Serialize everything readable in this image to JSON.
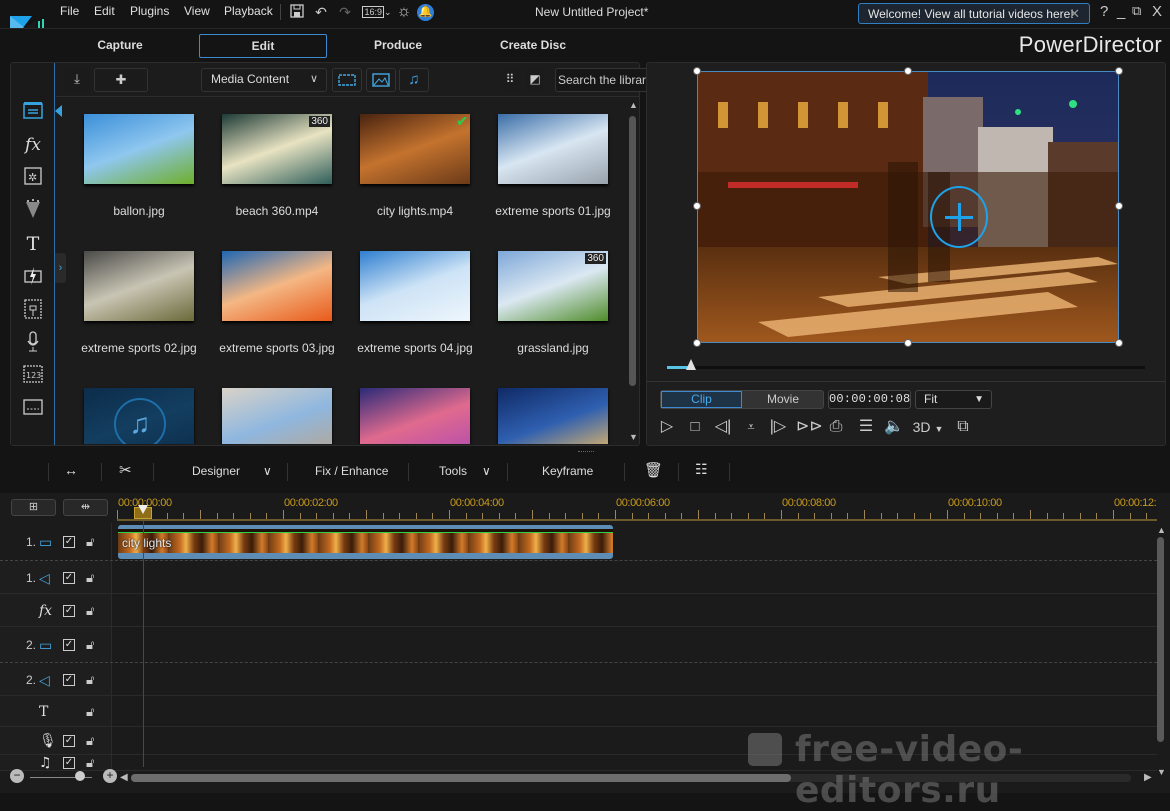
{
  "app": {
    "project_title": "New Untitled Project*",
    "brand": "PowerDirector",
    "welcome_tip": "Welcome! View all tutorial videos here!",
    "aspect_ratio": "16:9"
  },
  "menu": [
    "File",
    "Edit",
    "Plugins",
    "View",
    "Playback"
  ],
  "window_controls": {
    "help": "?",
    "minimize": "_",
    "restore": "⧉",
    "close": "X"
  },
  "modes": [
    {
      "label": "Capture",
      "active": false
    },
    {
      "label": "Edit",
      "active": true
    },
    {
      "label": "Produce",
      "active": false
    },
    {
      "label": "Create Disc",
      "active": false
    }
  ],
  "rooms": [
    {
      "name": "media-room",
      "glyph": "🎬",
      "active": true
    },
    {
      "name": "fx-room",
      "glyph": "fx"
    },
    {
      "name": "pip-room",
      "glyph": "✲"
    },
    {
      "name": "particle-room",
      "glyph": "▼"
    },
    {
      "name": "title-room",
      "glyph": "T"
    },
    {
      "name": "transition-room",
      "glyph": "ϟ"
    },
    {
      "name": "audio-mixing-room",
      "glyph": "⊞"
    },
    {
      "name": "voiceover-room",
      "glyph": "🎙"
    },
    {
      "name": "chapter-room",
      "glyph": "123"
    },
    {
      "name": "subtitle-room",
      "glyph": "▭"
    }
  ],
  "library": {
    "content_filter": "Media Content",
    "search_placeholder": "Search the library",
    "items": [
      {
        "name": "ballon.jpg",
        "badge": "",
        "used": false,
        "colors": [
          "#3b8fd9",
          "#8fc7ef",
          "#6fae2a"
        ]
      },
      {
        "name": "beach 360.mp4",
        "badge": "360",
        "used": false,
        "colors": [
          "#1d3a36",
          "#e8e3c2",
          "#2f5e5a"
        ]
      },
      {
        "name": "city lights.mp4",
        "badge": "",
        "used": true,
        "colors": [
          "#4a2310",
          "#c4732e",
          "#6b3a18"
        ]
      },
      {
        "name": "extreme sports 01.jpg",
        "badge": "",
        "used": false,
        "colors": [
          "#3a6ea8",
          "#d8e6f2",
          "#98a2ac"
        ]
      },
      {
        "name": "extreme sports 02.jpg",
        "badge": "",
        "used": false,
        "colors": [
          "#4a4a48",
          "#c9c5b4",
          "#6a6a3a"
        ]
      },
      {
        "name": "extreme sports 03.jpg",
        "badge": "",
        "used": false,
        "colors": [
          "#1f66b3",
          "#f4b784",
          "#e85a1a"
        ]
      },
      {
        "name": "extreme sports 04.jpg",
        "badge": "",
        "used": false,
        "colors": [
          "#2f7fd0",
          "#cde3f6",
          "#eef6fc"
        ]
      },
      {
        "name": "grassland.jpg",
        "badge": "360",
        "used": false,
        "colors": [
          "#7ea7d8",
          "#dbe8f2",
          "#4f8c2a"
        ]
      },
      {
        "name": "",
        "badge": "",
        "used": false,
        "music": true,
        "colors": [
          "#0c2c4a",
          "#133e60",
          "#0c2c4a"
        ]
      },
      {
        "name": "",
        "badge": "",
        "used": false,
        "colors": [
          "#d9d3c8",
          "#8fb7df",
          "#b8a58e"
        ]
      },
      {
        "name": "",
        "badge": "",
        "used": false,
        "colors": [
          "#2a2a78",
          "#e06a8e",
          "#b04ab0"
        ]
      },
      {
        "name": "",
        "badge": "",
        "used": false,
        "colors": [
          "#0f2a66",
          "#2f5fb0",
          "#f4c060"
        ]
      }
    ]
  },
  "preview": {
    "mode_clip": "Clip",
    "mode_movie": "Movie",
    "active_mode": "Clip",
    "timecode": "00:00:00:08",
    "zoom": "Fit",
    "scrub_position": 0.05,
    "threed_label": "3D"
  },
  "edit_toolbar": {
    "designer": "Designer",
    "fix_enhance": "Fix / Enhance",
    "tools": "Tools",
    "keyframe": "Keyframe"
  },
  "timeline": {
    "ruler_labels": [
      "00:00:00:00",
      "00:00:02:00",
      "00:00:04:00",
      "00:00:06:00",
      "00:00:08:00",
      "00:00:10:00",
      "00:00:12:"
    ],
    "clip_name": "city lights",
    "tracks": [
      {
        "num": "1.",
        "type": "video",
        "glyph": "▭",
        "checked": true,
        "locked": false
      },
      {
        "num": "1.",
        "type": "audio",
        "glyph": "◁",
        "checked": true,
        "locked": false
      },
      {
        "num": "",
        "type": "fx",
        "glyph": "fx",
        "checked": true,
        "locked": false
      },
      {
        "num": "2.",
        "type": "video",
        "glyph": "▭",
        "checked": true,
        "locked": false
      },
      {
        "num": "2.",
        "type": "audio",
        "glyph": "◁",
        "checked": true,
        "locked": false
      },
      {
        "num": "",
        "type": "title",
        "glyph": "T",
        "checked": null,
        "locked": false
      },
      {
        "num": "",
        "type": "voice",
        "glyph": "🎙",
        "checked": true,
        "locked": false
      },
      {
        "num": "",
        "type": "music",
        "glyph": "♫",
        "checked": true,
        "locked": false
      }
    ],
    "zoom_level": 0.8,
    "hscroll_fraction": 0.66
  },
  "watermark": "free-video-editors.ru"
}
